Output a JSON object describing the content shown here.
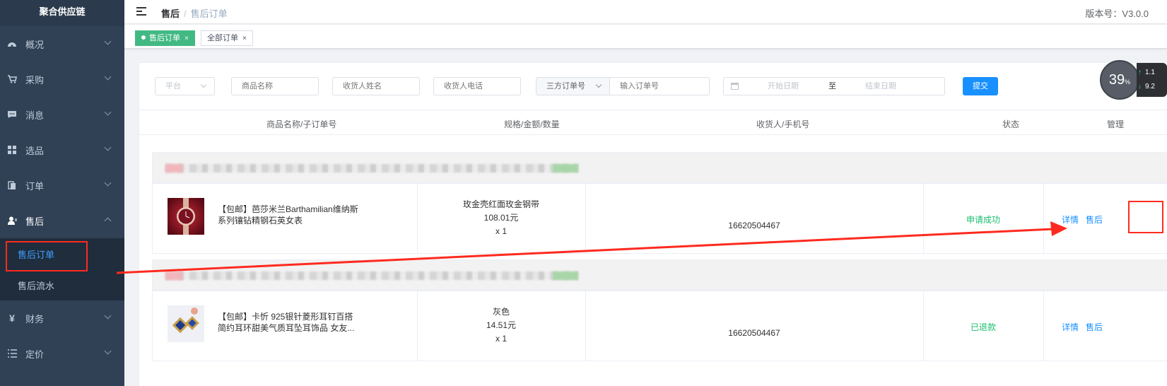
{
  "sidebar": {
    "brand": "聚合供应链",
    "items": [
      {
        "label": "概况",
        "icon": "dashboard-icon"
      },
      {
        "label": "采购",
        "icon": "cart-icon"
      },
      {
        "label": "消息",
        "icon": "message-icon"
      },
      {
        "label": "选品",
        "icon": "grid-icon"
      },
      {
        "label": "订单",
        "icon": "order-icon"
      },
      {
        "label": "售后",
        "icon": "user-icon"
      },
      {
        "label": "财务",
        "icon": "yen-icon"
      },
      {
        "label": "定价",
        "icon": "list-icon"
      }
    ],
    "aftersale_sub": [
      {
        "label": "售后订单"
      },
      {
        "label": "售后流水"
      }
    ],
    "yen_glyph": "¥"
  },
  "header": {
    "breadcrumb_1": "售后",
    "breadcrumb_sep": "/",
    "breadcrumb_2": "售后订单",
    "version": "版本号：V3.0.0"
  },
  "tags": {
    "active": "售后订单",
    "other": "全部订单",
    "close": "×"
  },
  "filters": {
    "platform_placeholder": "平台",
    "product_name_placeholder": "商品名称",
    "receiver_name_placeholder": "收货人姓名",
    "receiver_phone_placeholder": "收货人电话",
    "order_type": "三方订单号",
    "order_no_placeholder": "输入订单号",
    "start_date": "开始日期",
    "date_sep": "至",
    "end_date": "结束日期",
    "submit": "提交"
  },
  "table": {
    "headers": [
      "商品名称/子订单号",
      "规格/金额/数量",
      "收货人/手机号",
      "状态",
      "管理"
    ],
    "rows": [
      {
        "product": "【包邮】芭莎米兰Barthamilian维纳斯系列镶钻精钢石英女表",
        "spec": "玫金壳红面玫金钢带",
        "amount": "108.01元",
        "qty": "x 1",
        "phone": "16620504467",
        "status": "申请成功",
        "detail": "详情",
        "aftersale": "售后"
      },
      {
        "product": "【包邮】卡忻 925银针菱形耳钉百搭简约耳环甜美气质耳坠耳饰品 女友...",
        "spec": "灰色",
        "amount": "14.51元",
        "qty": "x 1",
        "phone": "16620504467",
        "status": "已退款",
        "detail": "详情",
        "aftersale": "售后"
      }
    ]
  },
  "net_widget": {
    "percent": "39",
    "percent_sign": "%",
    "up": "1.1",
    "down": "9.2",
    "up_arrow": "↑",
    "down_arrow": "↓"
  },
  "colors": {
    "sidebar_bg": "#304156",
    "active_tag": "#42b983",
    "primary": "#1890ff",
    "status_green": "#19be6b",
    "annotation_red": "#ff2a1f"
  }
}
